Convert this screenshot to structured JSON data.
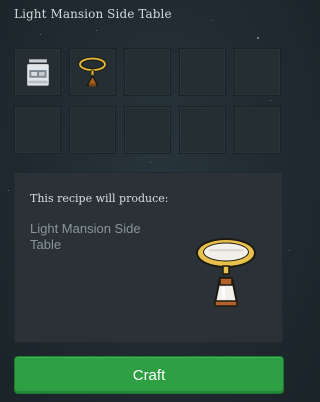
{
  "window": {
    "title": "Light Mansion Side Table"
  },
  "ingredients": [
    {
      "icon": "paint-bucket-icon"
    },
    {
      "icon": "lamp-frame-icon"
    },
    {
      "icon": ""
    },
    {
      "icon": ""
    },
    {
      "icon": ""
    },
    {
      "icon": ""
    },
    {
      "icon": ""
    },
    {
      "icon": ""
    },
    {
      "icon": ""
    },
    {
      "icon": ""
    }
  ],
  "result": {
    "heading": "This recipe will produce:",
    "name": "Light Mansion Side Table",
    "icon": "side-table-icon"
  },
  "actions": {
    "craft_label": "Craft"
  },
  "colors": {
    "accent": "#2ea043",
    "background": "#1f292f",
    "panel": "#2a3237"
  }
}
